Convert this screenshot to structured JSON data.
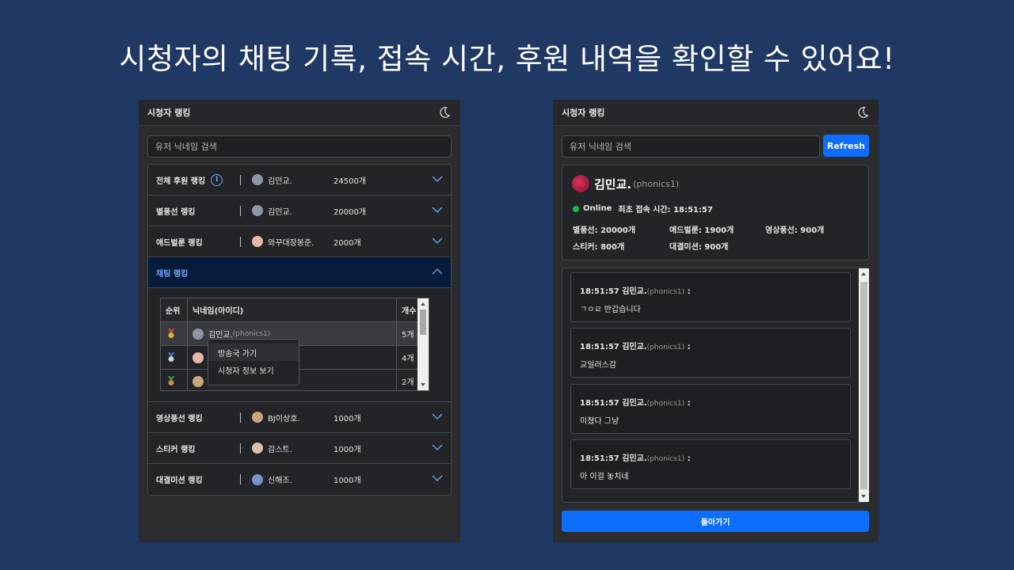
{
  "headline": "시청자의 채팅 기록, 접속 시간, 후원 내역을 확인할 수 있어요!",
  "left_panel": {
    "title": "시청자 랭킹",
    "search_placeholder": "유저 닉네임 검색",
    "rows_top": [
      {
        "name": "전체 후원 랭킹",
        "info": "i",
        "user": "김민교.",
        "count": "24500개",
        "avatar_color": "#8e96a8"
      },
      {
        "name": "별풍선 랭킹",
        "user": "김민교.",
        "count": "20000개",
        "avatar_color": "#8e96a8"
      },
      {
        "name": "애드벌룬 랭킹",
        "user": "와꾸대장봉준.",
        "count": "2000개",
        "avatar_color": "#e8b7a5"
      }
    ],
    "active_row": {
      "name": "채팅 랭킹"
    },
    "table": {
      "headers": [
        "순위",
        "닉네임(아이디)",
        "개수"
      ],
      "rows": [
        {
          "nick": "김민교.",
          "id": "(phonics1)",
          "count": "5개",
          "medal": "gold"
        },
        {
          "nick": "",
          "id": "",
          "count": "4개",
          "medal": "silver"
        },
        {
          "nick": "",
          "id": "",
          "count": "2개",
          "medal": "bronze"
        }
      ]
    },
    "context_menu": [
      "방송국 가기",
      "시청자 정보 보기"
    ],
    "rows_bottom": [
      {
        "name": "영상풍선 랭킹",
        "user": "BJ이상호.",
        "count": "1000개",
        "avatar_color": "#c7a67a"
      },
      {
        "name": "스티커 랭킹",
        "user": "감스트.",
        "count": "1000개",
        "avatar_color": "#d9c0b0"
      },
      {
        "name": "대결미션 랭킹",
        "user": "신해조.",
        "count": "1000개",
        "avatar_color": "#7c93c9"
      }
    ]
  },
  "right_panel": {
    "title": "시청자 랭킹",
    "search_placeholder": "유저 닉네임 검색",
    "refresh_label": "Refresh",
    "profile": {
      "name": "김민교.",
      "id": "(phonics1)",
      "status": "Online",
      "first_seen": "최초 접속 시간: 18:51:57",
      "stats": [
        "별풍선: 20000개",
        "애드벌룬: 1900개",
        "영상풍선: 900개",
        "스티커: 800개",
        "대결미션: 900개"
      ]
    },
    "messages": [
      {
        "time": "18:51:57",
        "nick": "김민교.",
        "id": "(phonics1)",
        "sep": ":",
        "text": "ㄱㅇㄹ 반갑습니다"
      },
      {
        "time": "18:51:57",
        "nick": "김민교.",
        "id": "(phonics1)",
        "sep": ":",
        "text": "교일러스감"
      },
      {
        "time": "18:51:57",
        "nick": "김민교.",
        "id": "(phonics1)",
        "sep": ":",
        "text": "미쳤다 그냥"
      },
      {
        "time": "18:51:57",
        "nick": "김민교.",
        "id": "(phonics1)",
        "sep": ":",
        "text": "아 이걸 놓치네"
      }
    ],
    "back_label": "돌아가기"
  },
  "colors": {
    "background": "#203864",
    "panel": "#2b2c2e",
    "accent": "#0d6efd",
    "online": "#22b14c",
    "active_text": "#6ea8fe"
  }
}
